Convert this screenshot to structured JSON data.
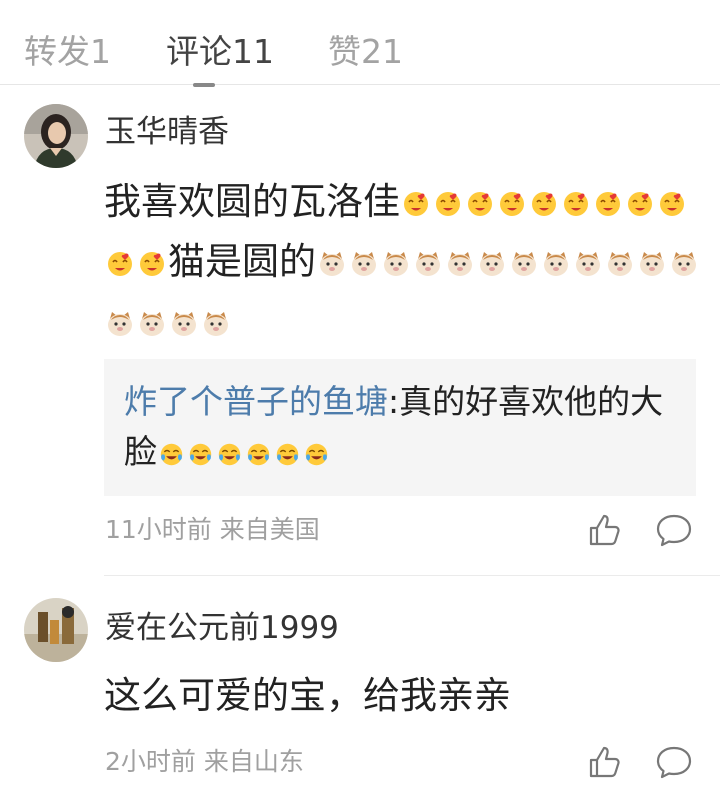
{
  "tabs": [
    {
      "label": "转发1"
    },
    {
      "label": "评论11"
    },
    {
      "label": "赞21"
    }
  ],
  "comments": [
    {
      "username": "玉华晴香",
      "text_a": "我喜欢圆的瓦洛佳",
      "text_b": "猫是圆的",
      "emoji_a": "heart-face-emoji",
      "emoji_b": "cat-emoji",
      "reply": {
        "user": "炸了个普子的鱼塘",
        "separator": ":",
        "text": "真的好喜欢他的大脸",
        "emoji": "laughing-tears-emoji"
      },
      "meta": "11小时前 来自美国"
    },
    {
      "username": "爱在公元前1999",
      "text": "这么可爱的宝，给我亲亲",
      "meta": "2小时前 来自山东"
    }
  ],
  "icons": {
    "like": "thumbs-up-icon",
    "comment": "comment-bubble-icon"
  },
  "colors": {
    "reply_user": "#4d7cab",
    "meta": "#a0a0a0",
    "tab_inactive": "#a3a3a3",
    "reply_bg": "#f5f5f5"
  }
}
